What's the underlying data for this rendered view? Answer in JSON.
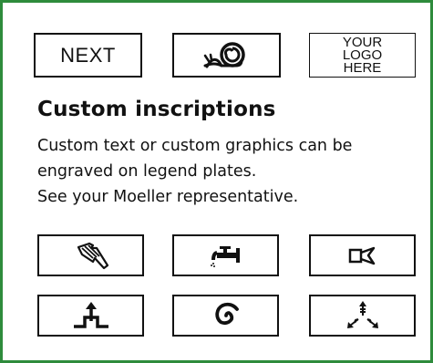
{
  "frame": {
    "border_color": "#2e8b3c"
  },
  "top_plates": {
    "next_label": "NEXT",
    "snail_icon": "snail-icon",
    "logo_lines": [
      "YOUR",
      "LOGO",
      "HERE"
    ]
  },
  "section": {
    "heading": "Custom inscriptions",
    "body_lines": [
      "Custom text or custom graphics can be",
      "engraved on legend plates.",
      "See your Moeller representative."
    ]
  },
  "symbol_plates": [
    {
      "icon": "hand-wiping-icon"
    },
    {
      "icon": "water-tap-icon"
    },
    {
      "icon": "horn-icon"
    },
    {
      "icon": "arrow-up-lift-icon"
    },
    {
      "icon": "spiral-icon"
    },
    {
      "icon": "three-way-arrows-icon"
    }
  ]
}
